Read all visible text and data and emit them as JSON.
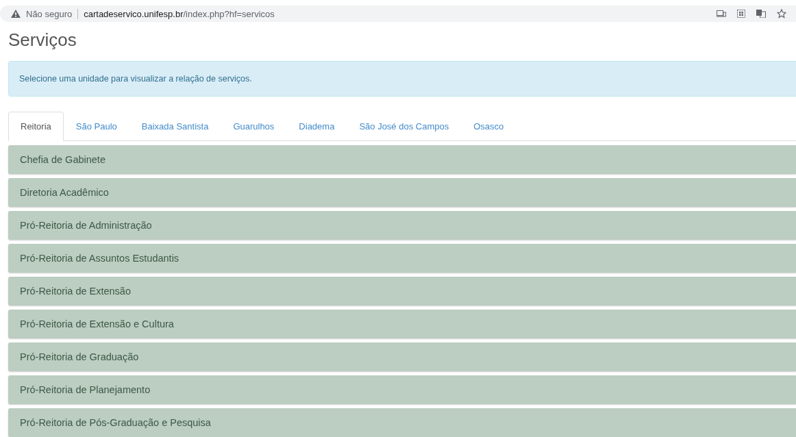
{
  "address_bar": {
    "security": "Não seguro",
    "host": "cartadeservico.unifesp.br",
    "path": "/index.php?hf=servicos"
  },
  "page_title": "Serviços",
  "alert": "Selecione uma unidade para visualizar a relação de serviços.",
  "tabs": [
    {
      "label": "Reitoria",
      "selected": true
    },
    {
      "label": "São Paulo",
      "selected": false
    },
    {
      "label": "Baixada Santista",
      "selected": false
    },
    {
      "label": "Guarulhos",
      "selected": false
    },
    {
      "label": "Diadema",
      "selected": false
    },
    {
      "label": "São José dos Campos",
      "selected": false
    },
    {
      "label": "Osasco",
      "selected": false
    }
  ],
  "panels": [
    "Chefia de Gabinete",
    "Diretoria Acadêmico",
    "Pró-Reitoria de Administração",
    "Pró-Reitoria de Assuntos Estudantis",
    "Pró-Reitoria de Extensão",
    "Pró-Reitoria de Extensão e Cultura",
    "Pró-Reitoria de Graduação",
    "Pró-Reitoria de Planejamento",
    "Pró-Reitoria de Pós-Graduação e Pesquisa"
  ]
}
